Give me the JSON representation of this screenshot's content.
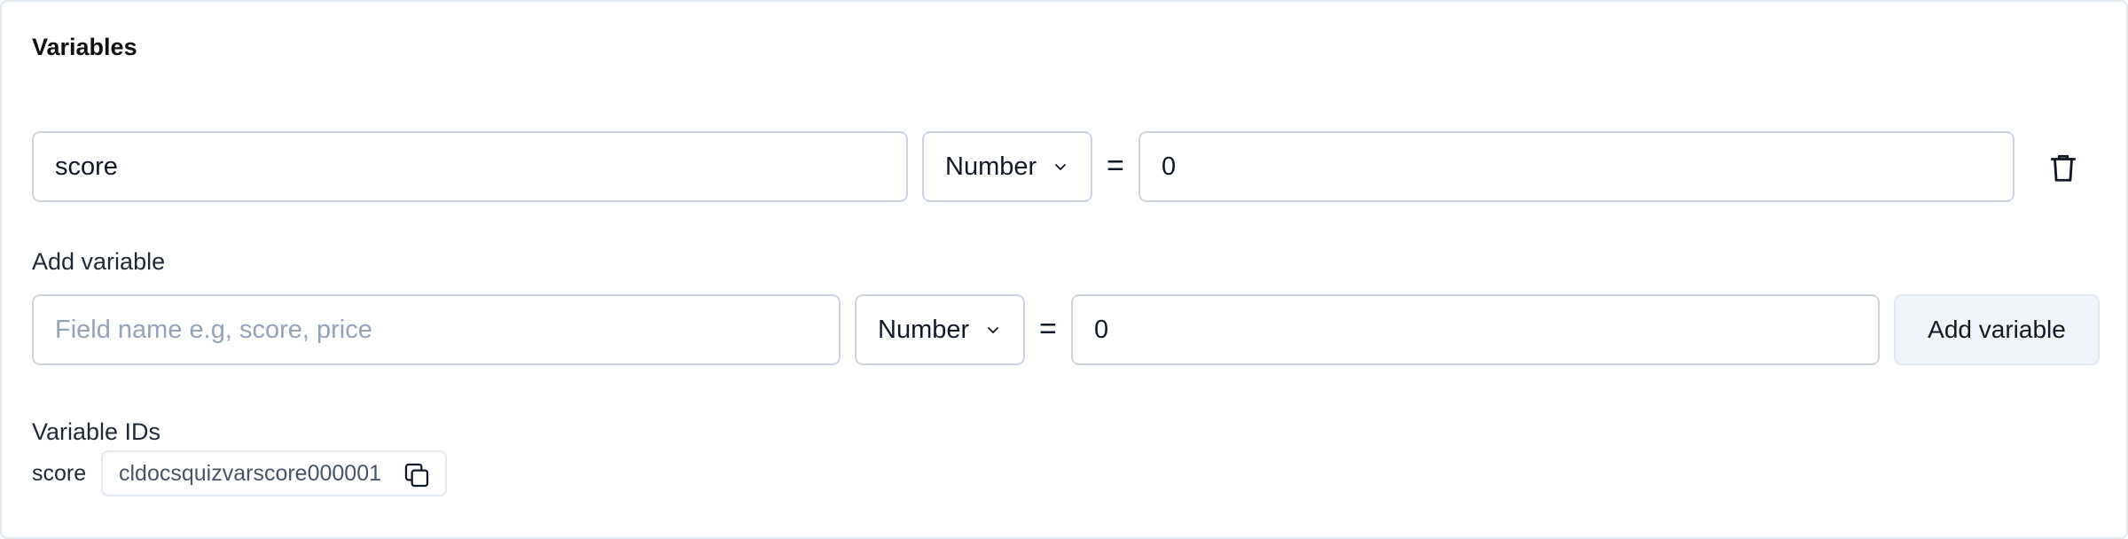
{
  "panel": {
    "title": "Variables"
  },
  "existing_variable": {
    "name": "score",
    "type": "Number",
    "equals": "=",
    "value": "0"
  },
  "add_variable": {
    "label": "Add variable",
    "name_value": "",
    "name_placeholder": "Field name e.g, score, price",
    "type": "Number",
    "equals": "=",
    "value": "0",
    "button_label": "Add variable"
  },
  "variable_ids": {
    "label": "Variable IDs",
    "items": [
      {
        "name": "score",
        "id": "cldocsquizvarscore000001"
      }
    ]
  },
  "icons": {
    "chevron": "chevron-down-icon",
    "trash": "trash-icon",
    "copy": "copy-icon"
  },
  "colors": {
    "border": "#cbd5e1",
    "placeholder": "#94a3b8",
    "button_bg": "#f1f5f9"
  }
}
